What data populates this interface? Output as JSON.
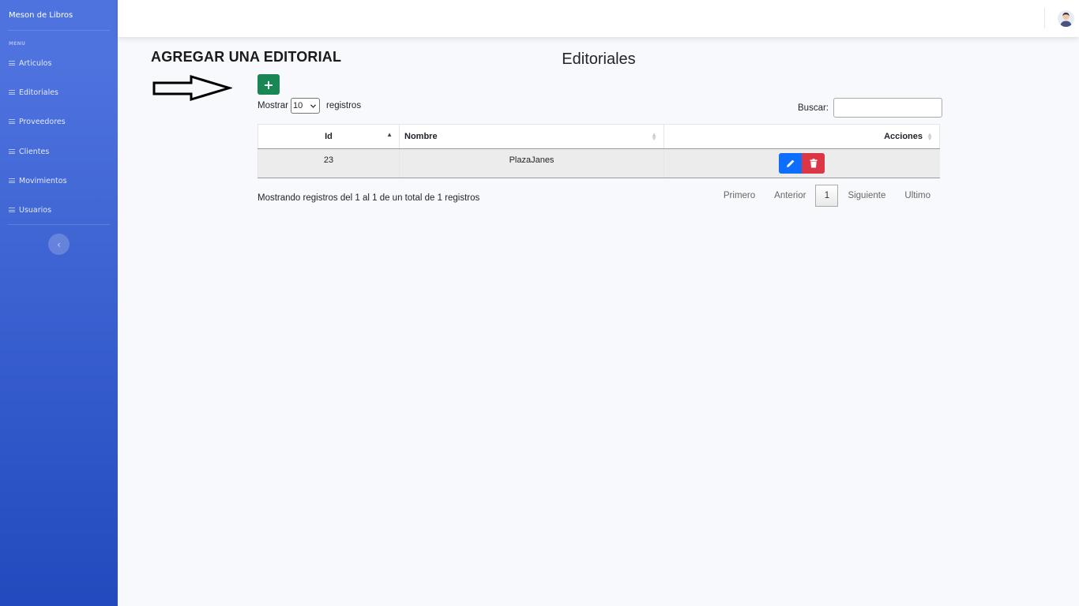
{
  "sidebar": {
    "brand": "Meson de Libros",
    "heading": "MENU",
    "items": [
      {
        "label": "Articulos"
      },
      {
        "label": "Editoriales"
      },
      {
        "label": "Proveedores"
      },
      {
        "label": "Clientes"
      },
      {
        "label": "Movimientos"
      },
      {
        "label": "Usuarios"
      }
    ],
    "toggle_icon": "‹"
  },
  "annotation": {
    "heading": "AGREGAR UNA EDITORIAL"
  },
  "main": {
    "title": "Editoriales",
    "add_icon": "+",
    "length": {
      "prefix": "Mostrar",
      "value": "10",
      "suffix": "registros"
    },
    "search": {
      "label": "Buscar:",
      "value": ""
    },
    "table": {
      "columns": [
        "Id",
        "Nombre",
        "Acciones"
      ],
      "rows": [
        {
          "id": "23",
          "nombre": "PlazaJanes"
        }
      ]
    },
    "info": "Mostrando registros del 1 al 1 de un total de 1 registros",
    "pagination": {
      "first": "Primero",
      "prev": "Anterior",
      "current": "1",
      "next": "Siguiente",
      "last": "Ultimo"
    }
  },
  "colors": {
    "sidebar_start": "#4e73df",
    "sidebar_end": "#224abe",
    "add": "#198754",
    "edit": "#0d6efd",
    "delete": "#dc3545"
  }
}
